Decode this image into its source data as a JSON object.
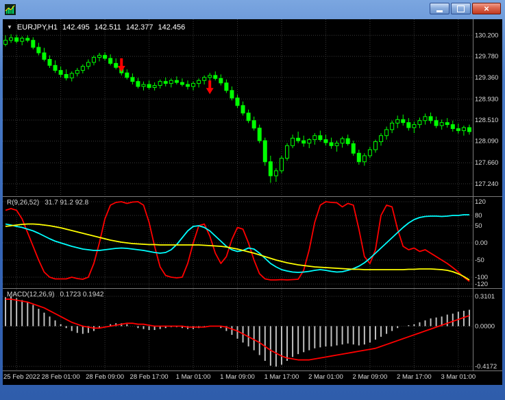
{
  "titlebar": {
    "close_glyph": "×"
  },
  "quote": {
    "dropdown_glyph": "▼",
    "symbol_period": "EURJPY,H1",
    "open": "142.495",
    "high": "142.511",
    "low": "142.377",
    "close": "142.456"
  },
  "colors": {
    "background": "#000000",
    "grid": "#3a3a3a",
    "candle": "#00ff00",
    "bull_fill": "#000000",
    "bear_fill": "#00ff00",
    "oscillator_fast": "#ff0000",
    "oscillator_mid": "#00ffff",
    "oscillator_slow": "#ffff00",
    "macd_histogram": "#c0c0c0",
    "macd_signal": "#ff0000",
    "axis_text": "#dcdcdc",
    "separator": "#7a7a7a",
    "arrow": "#ff0000"
  },
  "chart_data": {
    "type": "candlestick",
    "symbol": "EURJPY",
    "timeframe": "H1",
    "price_axis": {
      "range": [
        127.02,
        130.52
      ],
      "ticks": [
        130.2,
        129.78,
        129.36,
        128.93,
        128.51,
        128.09,
        127.66,
        127.24
      ],
      "labels": [
        "130.200",
        "129.780",
        "129.360",
        "128.930",
        "128.510",
        "128.090",
        "127.660",
        "127.240"
      ]
    },
    "time_axis": {
      "labels": [
        "25 Feb 2022",
        "28 Feb 01:00",
        "28 Feb 09:00",
        "28 Feb 17:00",
        "1 Mar 01:00",
        "1 Mar 09:00",
        "1 Mar 17:00",
        "2 Mar 01:00",
        "2 Mar 09:00",
        "2 Mar 17:00",
        "3 Mar 01:00"
      ],
      "tick_bars": [
        2,
        10,
        18,
        26,
        34,
        42,
        50,
        58,
        66,
        74,
        82
      ]
    },
    "candles": [
      [
        130.02,
        130.2,
        129.98,
        130.1
      ],
      [
        130.1,
        130.22,
        130.05,
        130.15
      ],
      [
        130.15,
        130.21,
        130.04,
        130.08
      ],
      [
        130.08,
        130.18,
        130.0,
        130.14
      ],
      [
        130.14,
        130.2,
        130.06,
        130.1
      ],
      [
        130.1,
        130.16,
        129.92,
        129.96
      ],
      [
        129.96,
        130.05,
        129.8,
        129.85
      ],
      [
        129.85,
        129.95,
        129.68,
        129.72
      ],
      [
        129.72,
        129.8,
        129.55,
        129.6
      ],
      [
        129.6,
        129.7,
        129.45,
        129.5
      ],
      [
        129.5,
        129.58,
        129.36,
        129.42
      ],
      [
        129.42,
        129.52,
        129.3,
        129.35
      ],
      [
        129.35,
        129.48,
        129.28,
        129.44
      ],
      [
        129.44,
        129.55,
        129.38,
        129.5
      ],
      [
        129.5,
        129.62,
        129.44,
        129.58
      ],
      [
        129.58,
        129.72,
        129.52,
        129.66
      ],
      [
        129.66,
        129.8,
        129.6,
        129.76
      ],
      [
        129.76,
        129.85,
        129.68,
        129.8
      ],
      [
        129.8,
        129.86,
        129.7,
        129.74
      ],
      [
        129.74,
        129.82,
        129.6,
        129.64
      ],
      [
        129.64,
        129.74,
        129.52,
        129.56
      ],
      [
        129.56,
        129.62,
        129.4,
        129.45
      ],
      [
        129.45,
        129.52,
        129.32,
        129.36
      ],
      [
        129.36,
        129.44,
        129.22,
        129.28
      ],
      [
        129.28,
        129.35,
        129.14,
        129.18
      ],
      [
        129.18,
        129.28,
        129.1,
        129.22
      ],
      [
        129.22,
        129.3,
        129.12,
        129.16
      ],
      [
        129.16,
        129.26,
        129.1,
        129.2
      ],
      [
        129.2,
        129.32,
        129.14,
        129.28
      ],
      [
        129.28,
        129.36,
        129.18,
        129.24
      ],
      [
        129.24,
        129.34,
        129.16,
        129.3
      ],
      [
        129.3,
        129.38,
        129.22,
        129.26
      ],
      [
        129.26,
        129.34,
        129.18,
        129.22
      ],
      [
        129.22,
        129.3,
        129.12,
        129.18
      ],
      [
        129.18,
        129.28,
        129.1,
        129.24
      ],
      [
        129.24,
        129.34,
        129.16,
        129.3
      ],
      [
        129.3,
        129.4,
        129.22,
        129.36
      ],
      [
        129.36,
        129.45,
        129.28,
        129.4
      ],
      [
        129.4,
        129.48,
        129.3,
        129.34
      ],
      [
        129.34,
        129.42,
        129.2,
        129.25
      ],
      [
        129.25,
        129.32,
        129.05,
        129.1
      ],
      [
        129.1,
        129.18,
        128.9,
        128.95
      ],
      [
        128.95,
        129.02,
        128.75,
        128.8
      ],
      [
        128.8,
        128.88,
        128.6,
        128.65
      ],
      [
        128.65,
        128.72,
        128.45,
        128.5
      ],
      [
        128.5,
        128.58,
        128.3,
        128.35
      ],
      [
        128.35,
        128.42,
        128.05,
        128.1
      ],
      [
        128.1,
        128.16,
        127.6,
        127.68
      ],
      [
        127.68,
        127.8,
        127.26,
        127.4
      ],
      [
        127.4,
        127.55,
        127.28,
        127.5
      ],
      [
        127.5,
        127.8,
        127.45,
        127.75
      ],
      [
        127.75,
        128.05,
        127.7,
        128.0
      ],
      [
        128.0,
        128.22,
        127.95,
        128.15
      ],
      [
        128.15,
        128.28,
        128.05,
        128.1
      ],
      [
        128.1,
        128.2,
        127.98,
        128.05
      ],
      [
        128.05,
        128.15,
        127.95,
        128.12
      ],
      [
        128.12,
        128.25,
        128.02,
        128.2
      ],
      [
        128.2,
        128.3,
        128.08,
        128.12
      ],
      [
        128.12,
        128.22,
        128.0,
        128.06
      ],
      [
        128.06,
        128.16,
        127.94,
        128.0
      ],
      [
        128.0,
        128.1,
        127.88,
        128.05
      ],
      [
        128.05,
        128.18,
        127.96,
        128.14
      ],
      [
        128.14,
        128.22,
        128.0,
        128.04
      ],
      [
        128.04,
        128.1,
        127.8,
        127.85
      ],
      [
        127.85,
        127.92,
        127.62,
        127.68
      ],
      [
        127.68,
        127.85,
        127.6,
        127.8
      ],
      [
        127.8,
        127.98,
        127.75,
        127.92
      ],
      [
        127.92,
        128.12,
        127.86,
        128.08
      ],
      [
        128.08,
        128.25,
        128.0,
        128.2
      ],
      [
        128.2,
        128.38,
        128.12,
        128.32
      ],
      [
        128.32,
        128.5,
        128.25,
        128.45
      ],
      [
        128.45,
        128.6,
        128.35,
        128.52
      ],
      [
        128.52,
        128.62,
        128.4,
        128.46
      ],
      [
        128.46,
        128.55,
        128.3,
        128.36
      ],
      [
        128.36,
        128.48,
        128.25,
        128.42
      ],
      [
        128.42,
        128.56,
        128.35,
        128.5
      ],
      [
        128.5,
        128.64,
        128.42,
        128.58
      ],
      [
        128.58,
        128.66,
        128.44,
        128.5
      ],
      [
        128.5,
        128.58,
        128.35,
        128.4
      ],
      [
        128.4,
        128.52,
        128.32,
        128.46
      ],
      [
        128.46,
        128.55,
        128.36,
        128.42
      ],
      [
        128.42,
        128.5,
        128.28,
        128.34
      ],
      [
        128.34,
        128.44,
        128.24,
        128.3
      ],
      [
        128.3,
        128.4,
        128.2,
        128.36
      ],
      [
        128.36,
        128.42,
        128.22,
        128.28
      ]
    ],
    "arrows": [
      {
        "bar": 21,
        "price": 129.74,
        "direction": "down"
      },
      {
        "bar": 37,
        "price": 129.3,
        "direction": "down"
      }
    ],
    "oscillator": {
      "name": "R(9,26,52)",
      "values_text": "31.7 91.2 92.8",
      "range": [
        -132,
        132
      ],
      "levels": [
        120,
        80,
        50,
        0,
        -50,
        -100,
        -120
      ],
      "level_labels": [
        "120",
        "80",
        "50",
        "0.00",
        "-50",
        "-100",
        "-120"
      ],
      "series": [
        {
          "name": "fast",
          "color": "#ff0000",
          "values": [
            95,
            100,
            95,
            70,
            30,
            -10,
            -50,
            -85,
            -100,
            -105,
            -105,
            -105,
            -100,
            -104,
            -106,
            -100,
            -60,
            0,
            70,
            110,
            118,
            120,
            115,
            119,
            120,
            110,
            60,
            -10,
            -70,
            -95,
            -100,
            -102,
            -100,
            -60,
            0,
            50,
            55,
            20,
            -30,
            -60,
            -40,
            10,
            45,
            40,
            0,
            -50,
            -90,
            -105,
            -108,
            -108,
            -107,
            -108,
            -107,
            -106,
            -80,
            -20,
            60,
            110,
            120,
            118,
            117,
            105,
            115,
            110,
            40,
            -40,
            -60,
            -20,
            80,
            110,
            105,
            40,
            -10,
            -20,
            -15,
            -25,
            -20,
            -30,
            -40,
            -50,
            -60,
            -72,
            -85,
            -100,
            -112
          ]
        },
        {
          "name": "mid",
          "color": "#00ffff",
          "values": [
            55,
            52,
            48,
            45,
            40,
            35,
            28,
            20,
            12,
            5,
            0,
            -5,
            -10,
            -14,
            -18,
            -20,
            -22,
            -22,
            -20,
            -18,
            -16,
            -15,
            -16,
            -18,
            -20,
            -22,
            -25,
            -28,
            -30,
            -28,
            -20,
            -5,
            15,
            35,
            48,
            50,
            45,
            35,
            20,
            5,
            -10,
            -20,
            -25,
            -22,
            -15,
            -18,
            -30,
            -45,
            -60,
            -70,
            -78,
            -82,
            -85,
            -86,
            -85,
            -83,
            -80,
            -78,
            -80,
            -83,
            -85,
            -84,
            -80,
            -75,
            -68,
            -58,
            -45,
            -30,
            -15,
            0,
            15,
            30,
            45,
            58,
            68,
            74,
            77,
            78,
            78,
            77,
            78,
            80,
            80,
            82,
            82
          ]
        },
        {
          "name": "slow",
          "color": "#ffff00",
          "values": [
            48,
            50,
            52,
            54,
            55,
            55,
            54,
            52,
            50,
            47,
            44,
            40,
            36,
            32,
            28,
            24,
            20,
            16,
            12,
            8,
            5,
            2,
            0,
            -2,
            -3,
            -4,
            -5,
            -5,
            -6,
            -6,
            -6,
            -6,
            -6,
            -6,
            -6,
            -6,
            -7,
            -8,
            -9,
            -10,
            -12,
            -15,
            -18,
            -22,
            -26,
            -30,
            -35,
            -40,
            -45,
            -50,
            -54,
            -58,
            -61,
            -64,
            -66,
            -68,
            -70,
            -71,
            -72,
            -73,
            -74,
            -75,
            -76,
            -77,
            -77,
            -78,
            -78,
            -78,
            -78,
            -78,
            -78,
            -78,
            -78,
            -77,
            -77,
            -76,
            -76,
            -76,
            -77,
            -78,
            -80,
            -84,
            -90,
            -98,
            -108
          ]
        }
      ]
    },
    "macd": {
      "name": "MACD(12,26,9)",
      "values_text": "0.1723 0.1942",
      "range": [
        -0.46,
        0.38
      ],
      "ticks": [
        0.3101,
        0,
        -0.4172
      ],
      "tick_labels": [
        "0.3101",
        "0.0000",
        "-0.4172"
      ],
      "histogram": [
        0.3,
        0.31,
        0.29,
        0.27,
        0.25,
        0.22,
        0.18,
        0.14,
        0.1,
        0.06,
        0.02,
        -0.02,
        -0.05,
        -0.07,
        -0.08,
        -0.07,
        -0.05,
        -0.02,
        0.0,
        0.02,
        0.03,
        0.03,
        0.02,
        0.0,
        -0.02,
        -0.03,
        -0.04,
        -0.04,
        -0.03,
        -0.02,
        -0.01,
        -0.01,
        -0.02,
        -0.03,
        -0.03,
        -0.02,
        -0.01,
        0.0,
        0.0,
        -0.02,
        -0.05,
        -0.09,
        -0.13,
        -0.17,
        -0.21,
        -0.25,
        -0.3,
        -0.36,
        -0.41,
        -0.42,
        -0.4,
        -0.36,
        -0.32,
        -0.29,
        -0.27,
        -0.25,
        -0.23,
        -0.22,
        -0.21,
        -0.21,
        -0.2,
        -0.19,
        -0.18,
        -0.19,
        -0.2,
        -0.19,
        -0.17,
        -0.14,
        -0.11,
        -0.08,
        -0.05,
        -0.02,
        0.0,
        0.01,
        0.02,
        0.04,
        0.06,
        0.08,
        0.09,
        0.1,
        0.12,
        0.13,
        0.15,
        0.16,
        0.17
      ],
      "signal": [
        0.28,
        0.28,
        0.27,
        0.26,
        0.25,
        0.23,
        0.21,
        0.19,
        0.16,
        0.13,
        0.1,
        0.07,
        0.04,
        0.02,
        0.0,
        -0.01,
        -0.02,
        -0.02,
        -0.01,
        0.0,
        0.01,
        0.02,
        0.03,
        0.03,
        0.02,
        0.02,
        0.01,
        0.0,
        0.0,
        0.0,
        0.0,
        0.0,
        0.0,
        -0.01,
        -0.01,
        -0.01,
        -0.01,
        0.0,
        0.0,
        0.0,
        -0.01,
        -0.03,
        -0.05,
        -0.08,
        -0.11,
        -0.14,
        -0.17,
        -0.21,
        -0.25,
        -0.28,
        -0.31,
        -0.33,
        -0.34,
        -0.35,
        -0.35,
        -0.35,
        -0.34,
        -0.33,
        -0.32,
        -0.31,
        -0.3,
        -0.29,
        -0.28,
        -0.27,
        -0.26,
        -0.25,
        -0.24,
        -0.23,
        -0.21,
        -0.19,
        -0.17,
        -0.15,
        -0.13,
        -0.11,
        -0.09,
        -0.07,
        -0.05,
        -0.03,
        -0.01,
        0.01,
        0.03,
        0.05,
        0.07,
        0.09,
        0.11
      ]
    }
  }
}
